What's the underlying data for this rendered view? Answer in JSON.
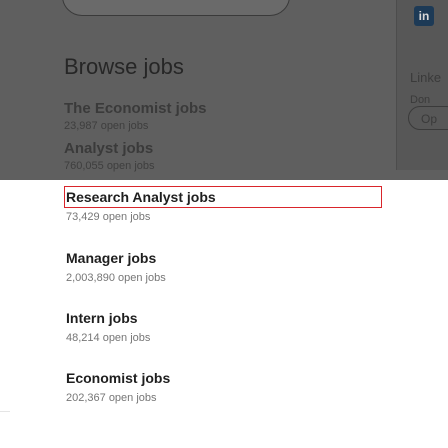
{
  "overlay": {
    "browse_title": "Browse jobs",
    "dim_jobs": [
      {
        "title": "The Economist jobs",
        "sub": "23,987 open jobs"
      },
      {
        "title": "Analyst jobs",
        "sub": "760,055 open jobs"
      }
    ]
  },
  "side_panel": {
    "logo": "in",
    "text1": "Linke",
    "text2": "Don",
    "button": "Op"
  },
  "jobs": [
    {
      "title": "Research Analyst jobs",
      "count": "73,429 open jobs"
    },
    {
      "title": "Manager jobs",
      "count": "2,003,890 open jobs"
    },
    {
      "title": "Intern jobs",
      "count": "48,214 open jobs"
    },
    {
      "title": "Economist jobs",
      "count": "202,367 open jobs"
    }
  ],
  "colors": {
    "overlay": "#5f5f5f",
    "highlight": "#d9252b",
    "title_text": "#1f1f1f",
    "count_text": "#767676"
  }
}
